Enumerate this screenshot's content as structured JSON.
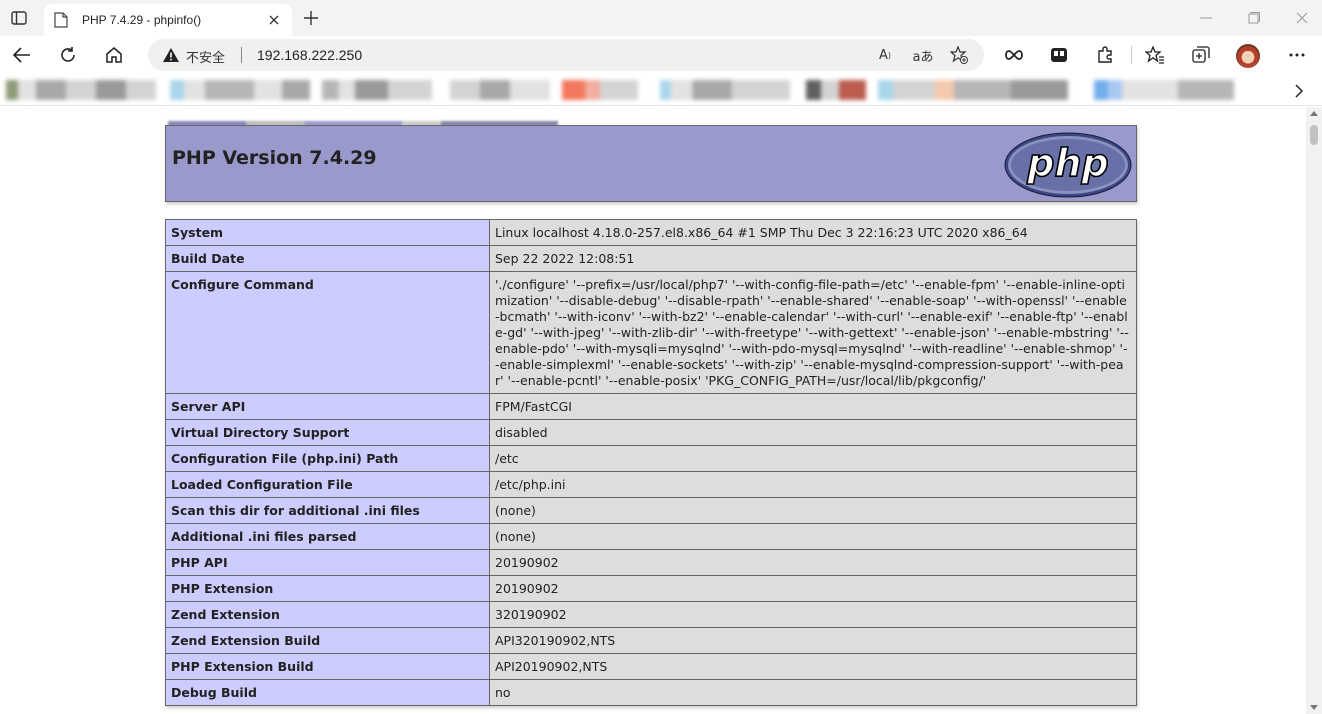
{
  "browser": {
    "tab_title": "PHP 7.4.29 - phpinfo()",
    "insecure_label": "不安全",
    "url": "192.168.222.250"
  },
  "colors": {
    "header_bg": "#9999cc",
    "label_cell_bg": "#ccccff",
    "value_cell_bg": "#dddddd"
  },
  "page": {
    "title": "PHP Version 7.4.29",
    "logo_text": "php",
    "rows": [
      {
        "label": "System",
        "value": "Linux localhost 4.18.0-257.el8.x86_64 #1 SMP Thu Dec 3 22:16:23 UTC 2020 x86_64"
      },
      {
        "label": "Build Date",
        "value": "Sep 22 2022 12:08:51"
      },
      {
        "label": "Configure Command",
        "value": "'./configure' '--prefix=/usr/local/php7' '--with-config-file-path=/etc' '--enable-fpm' '--enable-inline-optimization' '--disable-debug' '--disable-rpath' '--enable-shared' '--enable-soap' '--with-openssl' '--enable-bcmath' '--with-iconv' '--with-bz2' '--enable-calendar' '--with-curl' '--enable-exif' '--enable-ftp' '--enable-gd' '--with-jpeg' '--with-zlib-dir' '--with-freetype' '--with-gettext' '--enable-json' '--enable-mbstring' '--enable-pdo' '--with-mysqli=mysqlnd' '--with-pdo-mysql=mysqlnd' '--with-readline' '--enable-shmop' '--enable-simplexml' '--enable-sockets' '--with-zip' '--enable-mysqlnd-compression-support' '--with-pear' '--enable-pcntl' '--enable-posix' 'PKG_CONFIG_PATH=/usr/local/lib/pkgconfig/'"
      },
      {
        "label": "Server API",
        "value": "FPM/FastCGI"
      },
      {
        "label": "Virtual Directory Support",
        "value": "disabled"
      },
      {
        "label": "Configuration File (php.ini) Path",
        "value": "/etc"
      },
      {
        "label": "Loaded Configuration File",
        "value": "/etc/php.ini"
      },
      {
        "label": "Scan this dir for additional .ini files",
        "value": "(none)"
      },
      {
        "label": "Additional .ini files parsed",
        "value": "(none)"
      },
      {
        "label": "PHP API",
        "value": "20190902"
      },
      {
        "label": "PHP Extension",
        "value": "20190902"
      },
      {
        "label": "Zend Extension",
        "value": "320190902"
      },
      {
        "label": "Zend Extension Build",
        "value": "API320190902,NTS"
      },
      {
        "label": "PHP Extension Build",
        "value": "API20190902,NTS"
      },
      {
        "label": "Debug Build",
        "value": "no"
      }
    ]
  }
}
